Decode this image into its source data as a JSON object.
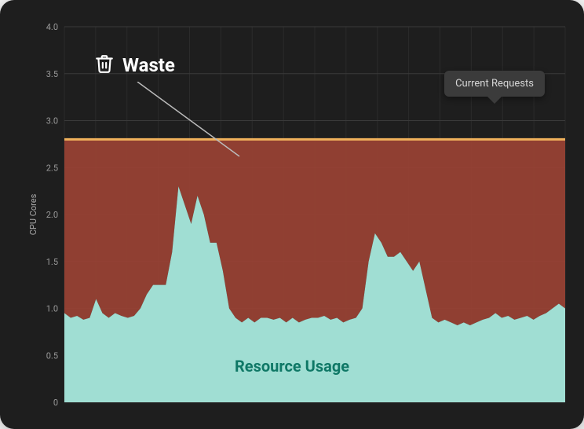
{
  "chart_data": {
    "type": "area",
    "ylabel": "CPU Cores",
    "xlabel": "",
    "ylim": [
      0,
      4.0
    ],
    "y_ticks": [
      0,
      0.5,
      1.0,
      1.5,
      2.0,
      2.5,
      3.0,
      3.5,
      4.0
    ],
    "y_tick_labels": [
      "0",
      "0.5",
      "1.0",
      "1.5",
      "2.0",
      "2.5",
      "3.0",
      "3.5",
      "4.0"
    ],
    "x": [
      0,
      1,
      2,
      3,
      4,
      5,
      6,
      7,
      8,
      9,
      10,
      11,
      12,
      13,
      14,
      15,
      16,
      17,
      18,
      19,
      20,
      21,
      22,
      23,
      24,
      25,
      26,
      27,
      28,
      29,
      30,
      31,
      32,
      33,
      34,
      35,
      36,
      37,
      38,
      39,
      40,
      41,
      42,
      43,
      44,
      45,
      46,
      47,
      48,
      49,
      50,
      51,
      52,
      53,
      54,
      55,
      56,
      57,
      58,
      59,
      60,
      61,
      62,
      63,
      64,
      65,
      66,
      67,
      68,
      69,
      70,
      71,
      72,
      73,
      74,
      75,
      76,
      77,
      78,
      79
    ],
    "series": [
      {
        "name": "Current Requests",
        "values": [
          2.8,
          2.8,
          2.8,
          2.8,
          2.8,
          2.8,
          2.8,
          2.8,
          2.8,
          2.8,
          2.8,
          2.8,
          2.8,
          2.8,
          2.8,
          2.8,
          2.8,
          2.8,
          2.8,
          2.8,
          2.8,
          2.8,
          2.8,
          2.8,
          2.8,
          2.8,
          2.8,
          2.8,
          2.8,
          2.8,
          2.8,
          2.8,
          2.8,
          2.8,
          2.8,
          2.8,
          2.8,
          2.8,
          2.8,
          2.8,
          2.8,
          2.8,
          2.8,
          2.8,
          2.8,
          2.8,
          2.8,
          2.8,
          2.8,
          2.8,
          2.8,
          2.8,
          2.8,
          2.8,
          2.8,
          2.8,
          2.8,
          2.8,
          2.8,
          2.8,
          2.8,
          2.8,
          2.8,
          2.8,
          2.8,
          2.8,
          2.8,
          2.8,
          2.8,
          2.8,
          2.8,
          2.8,
          2.8,
          2.8,
          2.8,
          2.8,
          2.8,
          2.8,
          2.8,
          2.8
        ],
        "color": "#f0b25c"
      },
      {
        "name": "Resource Usage",
        "values": [
          0.95,
          0.9,
          0.92,
          0.88,
          0.9,
          1.1,
          0.95,
          0.9,
          0.95,
          0.92,
          0.9,
          0.92,
          1.0,
          1.15,
          1.25,
          1.25,
          1.25,
          1.6,
          2.3,
          2.1,
          1.9,
          2.2,
          2.0,
          1.7,
          1.7,
          1.4,
          1.0,
          0.9,
          0.85,
          0.9,
          0.85,
          0.9,
          0.9,
          0.88,
          0.9,
          0.85,
          0.9,
          0.85,
          0.88,
          0.9,
          0.9,
          0.92,
          0.88,
          0.9,
          0.85,
          0.88,
          0.9,
          1.0,
          1.5,
          1.8,
          1.7,
          1.55,
          1.55,
          1.6,
          1.5,
          1.4,
          1.5,
          1.2,
          0.9,
          0.85,
          0.88,
          0.85,
          0.82,
          0.85,
          0.82,
          0.85,
          0.88,
          0.9,
          0.95,
          0.9,
          0.92,
          0.88,
          0.9,
          0.92,
          0.88,
          0.92,
          0.95,
          1.0,
          1.05,
          1.0
        ],
        "color": "#a0ded3"
      }
    ],
    "waste_region": {
      "between": [
        "Current Requests",
        "Resource Usage"
      ],
      "color": "#9a4234"
    },
    "annotations": {
      "waste_label": "Waste",
      "usage_label": "Resource Usage",
      "tooltip": "Current Requests"
    }
  },
  "yaxis_label": "CPU Cores"
}
